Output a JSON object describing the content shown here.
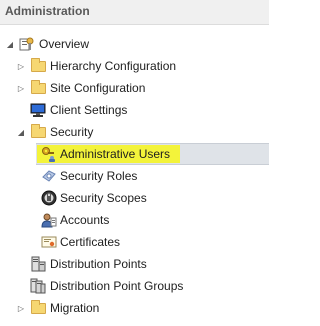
{
  "panel": {
    "title": "Administration"
  },
  "tree": {
    "overview": "Overview",
    "hierarchy_configuration": "Hierarchy Configuration",
    "site_configuration": "Site Configuration",
    "client_settings": "Client Settings",
    "security": "Security",
    "administrative_users": "Administrative Users",
    "security_roles": "Security Roles",
    "security_scopes": "Security Scopes",
    "accounts": "Accounts",
    "certificates": "Certificates",
    "distribution_points": "Distribution Points",
    "distribution_point_groups": "Distribution Point Groups",
    "migration": "Migration"
  },
  "icons": {
    "expanded": "expanded-triangle-icon",
    "collapsed": "collapsed-triangle-icon",
    "folder": "folder-icon",
    "overview": "overview-icon",
    "client_settings": "monitor-icon",
    "administrative_users": "key-user-icon",
    "security_roles": "role-icon",
    "security_scopes": "lock-icon",
    "accounts": "user-account-icon",
    "certificates": "certificate-icon",
    "distribution_points": "server-icon",
    "distribution_point_groups": "server-group-icon"
  },
  "colors": {
    "highlight": "#f3f33a",
    "selection": "#dfe3e8",
    "folder": "#f6d772"
  }
}
